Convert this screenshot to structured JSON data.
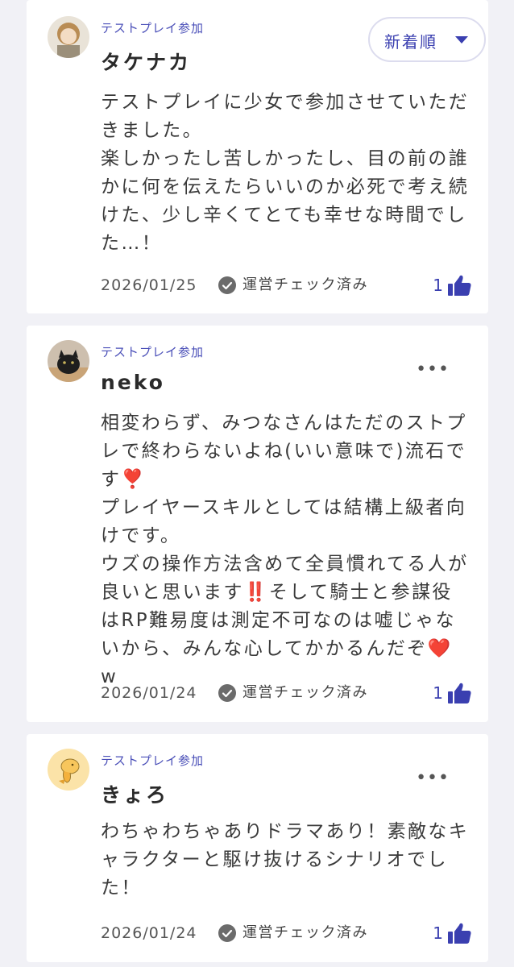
{
  "sort": {
    "label": "新着順"
  },
  "colors": {
    "accent": "#3a3fb0",
    "background": "#f1f1f6",
    "card": "#ffffff"
  },
  "reviews": [
    {
      "tag": "テストプレイ参加",
      "name": "タケナカ",
      "body": "テストプレイに少女で参加させていただきました。\n楽しかったし苦しかったし、目の前の誰かに何を伝えたらいいのか必死で考え続けた、少し辛くてとても幸せな時間でした…！",
      "date": "2026/01/25",
      "check": "運営チェック済み",
      "likes": "1",
      "avatar_icon": "user-photo-icon"
    },
    {
      "tag": "テストプレイ参加",
      "name": "neko",
      "body": "相変わらず、みつなさんはただのストプレで終わらないよね(いい意味で)流石です❣️\nプレイヤースキルとしては結構上級者向けです。\nウズの操作方法含めて全員慣れてる人が良いと思います‼️そして騎士と参謀役はRP難易度は測定不可なのは嘘じゃないから、みんな心してかかるんだぞ❤️ w",
      "date": "2026/01/24",
      "check": "運営チェック済み",
      "likes": "1",
      "avatar_icon": "cat-photo-icon"
    },
    {
      "tag": "テストプレイ参加",
      "name": "きょろ",
      "body": "わちゃわちゃありドラマあり！素敵なキャラクターと駆け抜けるシナリオでした！",
      "date": "2026/01/24",
      "check": "運営チェック済み",
      "likes": "1",
      "avatar_icon": "bird-illustration-icon"
    }
  ]
}
